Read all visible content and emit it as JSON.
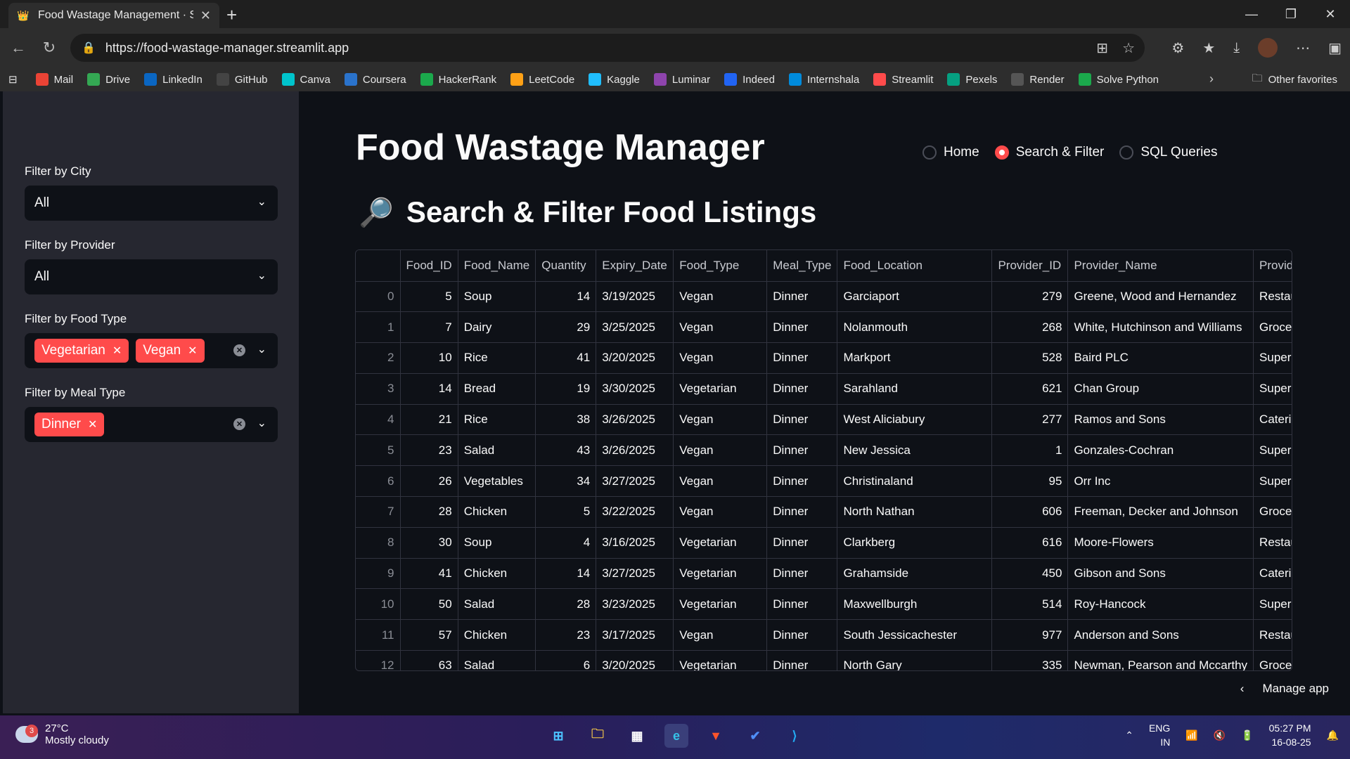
{
  "browser": {
    "tab_title": "Food Wastage Management · Stre",
    "url": "https://food-wastage-manager.streamlit.app",
    "bookmarks": [
      {
        "label": "Mail",
        "color": "#ea4335"
      },
      {
        "label": "Drive",
        "color": "#34a853"
      },
      {
        "label": "LinkedIn",
        "color": "#0a66c2"
      },
      {
        "label": "GitHub",
        "color": "#444444"
      },
      {
        "label": "Canva",
        "color": "#00c4cc"
      },
      {
        "label": "Coursera",
        "color": "#2a73cc"
      },
      {
        "label": "HackerRank",
        "color": "#1ba94c"
      },
      {
        "label": "LeetCode",
        "color": "#ffa116"
      },
      {
        "label": "Kaggle",
        "color": "#20beff"
      },
      {
        "label": "Luminar",
        "color": "#8e44ad"
      },
      {
        "label": "Indeed",
        "color": "#2164f3"
      },
      {
        "label": "Internshala",
        "color": "#008bdc"
      },
      {
        "label": "Streamlit",
        "color": "#ff4b4b"
      },
      {
        "label": "Pexels",
        "color": "#05a081"
      },
      {
        "label": "Render",
        "color": "#555555"
      },
      {
        "label": "Solve Python",
        "color": "#1ba94c"
      }
    ],
    "other_favorites": "Other favorites"
  },
  "sidebar": {
    "city_label": "Filter by City",
    "city_value": "All",
    "provider_label": "Filter by Provider",
    "provider_value": "All",
    "food_type_label": "Filter by Food Type",
    "food_type_chips": [
      "Vegetarian",
      "Vegan"
    ],
    "meal_type_label": "Filter by Meal Type",
    "meal_type_chips": [
      "Dinner"
    ]
  },
  "main": {
    "title": "Food Wastage Manager",
    "nav": [
      {
        "label": "Home",
        "selected": false
      },
      {
        "label": "Search & Filter",
        "selected": true
      },
      {
        "label": "SQL Queries",
        "selected": false
      }
    ],
    "section_title": "Search & Filter Food Listings",
    "manage_app": "Manage app"
  },
  "table": {
    "columns": [
      "",
      "Food_ID",
      "Food_Name",
      "Quantity",
      "Expiry_Date",
      "Food_Type",
      "Meal_Type",
      "Food_Location",
      "Provider_ID",
      "Provider_Name",
      "Provider"
    ],
    "rows": [
      [
        "0",
        "5",
        "Soup",
        "14",
        "3/19/2025",
        "Vegan",
        "Dinner",
        "Garciaport",
        "279",
        "Greene, Wood and Hernandez",
        "Restaura"
      ],
      [
        "1",
        "7",
        "Dairy",
        "29",
        "3/25/2025",
        "Vegan",
        "Dinner",
        "Nolanmouth",
        "268",
        "White, Hutchinson and Williams",
        "Grocery"
      ],
      [
        "2",
        "10",
        "Rice",
        "41",
        "3/20/2025",
        "Vegan",
        "Dinner",
        "Markport",
        "528",
        "Baird PLC",
        "Superma"
      ],
      [
        "3",
        "14",
        "Bread",
        "19",
        "3/30/2025",
        "Vegetarian",
        "Dinner",
        "Sarahland",
        "621",
        "Chan Group",
        "Superma"
      ],
      [
        "4",
        "21",
        "Rice",
        "38",
        "3/26/2025",
        "Vegan",
        "Dinner",
        "West Aliciabury",
        "277",
        "Ramos and Sons",
        "Catering"
      ],
      [
        "5",
        "23",
        "Salad",
        "43",
        "3/26/2025",
        "Vegan",
        "Dinner",
        "New Jessica",
        "1",
        "Gonzales-Cochran",
        "Superma"
      ],
      [
        "6",
        "26",
        "Vegetables",
        "34",
        "3/27/2025",
        "Vegan",
        "Dinner",
        "Christinaland",
        "95",
        "Orr Inc",
        "Superma"
      ],
      [
        "7",
        "28",
        "Chicken",
        "5",
        "3/22/2025",
        "Vegan",
        "Dinner",
        "North Nathan",
        "606",
        "Freeman, Decker and Johnson",
        "Grocery"
      ],
      [
        "8",
        "30",
        "Soup",
        "4",
        "3/16/2025",
        "Vegetarian",
        "Dinner",
        "Clarkberg",
        "616",
        "Moore-Flowers",
        "Restaura"
      ],
      [
        "9",
        "41",
        "Chicken",
        "14",
        "3/27/2025",
        "Vegetarian",
        "Dinner",
        "Grahamside",
        "450",
        "Gibson and Sons",
        "Catering"
      ],
      [
        "10",
        "50",
        "Salad",
        "28",
        "3/23/2025",
        "Vegetarian",
        "Dinner",
        "Maxwellburgh",
        "514",
        "Roy-Hancock",
        "Superma"
      ],
      [
        "11",
        "57",
        "Chicken",
        "23",
        "3/17/2025",
        "Vegan",
        "Dinner",
        "South Jessicachester",
        "977",
        "Anderson and Sons",
        "Restaura"
      ],
      [
        "12",
        "63",
        "Salad",
        "6",
        "3/20/2025",
        "Vegetarian",
        "Dinner",
        "North Gary",
        "335",
        "Newman, Pearson and Mccarthy",
        "Grocery"
      ]
    ]
  },
  "taskbar": {
    "weather_badge": "3",
    "temperature": "27°C",
    "condition": "Mostly cloudy",
    "language": "ENG",
    "region": "IN",
    "time": "05:27 PM",
    "date": "16-08-25"
  }
}
